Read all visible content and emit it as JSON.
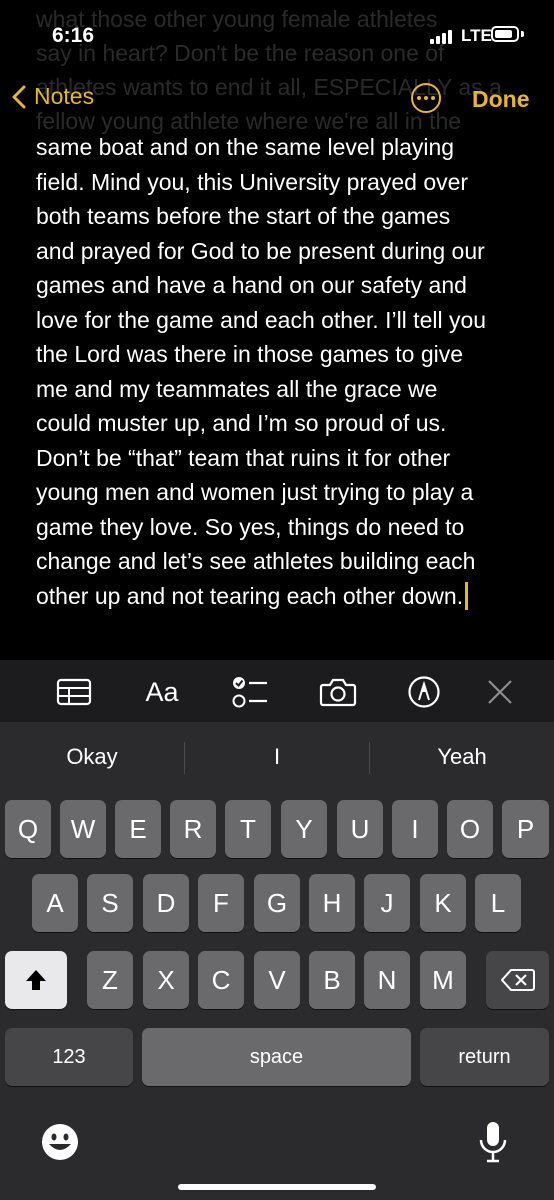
{
  "status_bar": {
    "time": "6:16",
    "network": "LTE"
  },
  "nav": {
    "back_label": "Notes",
    "done_label": "Done"
  },
  "note": {
    "scrolled_lines": [
      "what those other young female athletes",
      "say in heart? Don't be the reason one of",
      "athletes wants to end it all, ESPECIALLY as a",
      "fellow young athlete where we're all in the"
    ],
    "lines": [
      "same boat and on the same level playing",
      "field. Mind you, this University prayed over",
      "both teams before the start of the games",
      "and prayed for God to be present during our",
      "games and have a hand on our safety and",
      "love for the game and each other. I’ll tell you",
      "the Lord was there in those games to give",
      "me and my teammates all the grace we",
      "could muster up, and I’m so proud of us.",
      "Don’t be “that” team that ruins it for other",
      "young men and women just trying to play a",
      "game they love. So yes, things do need to",
      "change and let’s see athletes building each",
      "other up and not tearing each other down."
    ]
  },
  "toolbar": {
    "format_label": "Aa"
  },
  "keyboard": {
    "suggestions": [
      "Okay",
      "I",
      "Yeah"
    ],
    "row1": [
      "Q",
      "W",
      "E",
      "R",
      "T",
      "Y",
      "U",
      "I",
      "O",
      "P"
    ],
    "row2": [
      "A",
      "S",
      "D",
      "F",
      "G",
      "H",
      "J",
      "K",
      "L"
    ],
    "row3": [
      "Z",
      "X",
      "C",
      "V",
      "B",
      "N",
      "M"
    ],
    "numbers_label": "123",
    "space_label": "space",
    "return_label": "return"
  },
  "colors": {
    "accent": "#e8b62a",
    "background": "#000000",
    "keyboard_bg": "#2b2b2d",
    "key_bg": "#6a6a6c"
  }
}
